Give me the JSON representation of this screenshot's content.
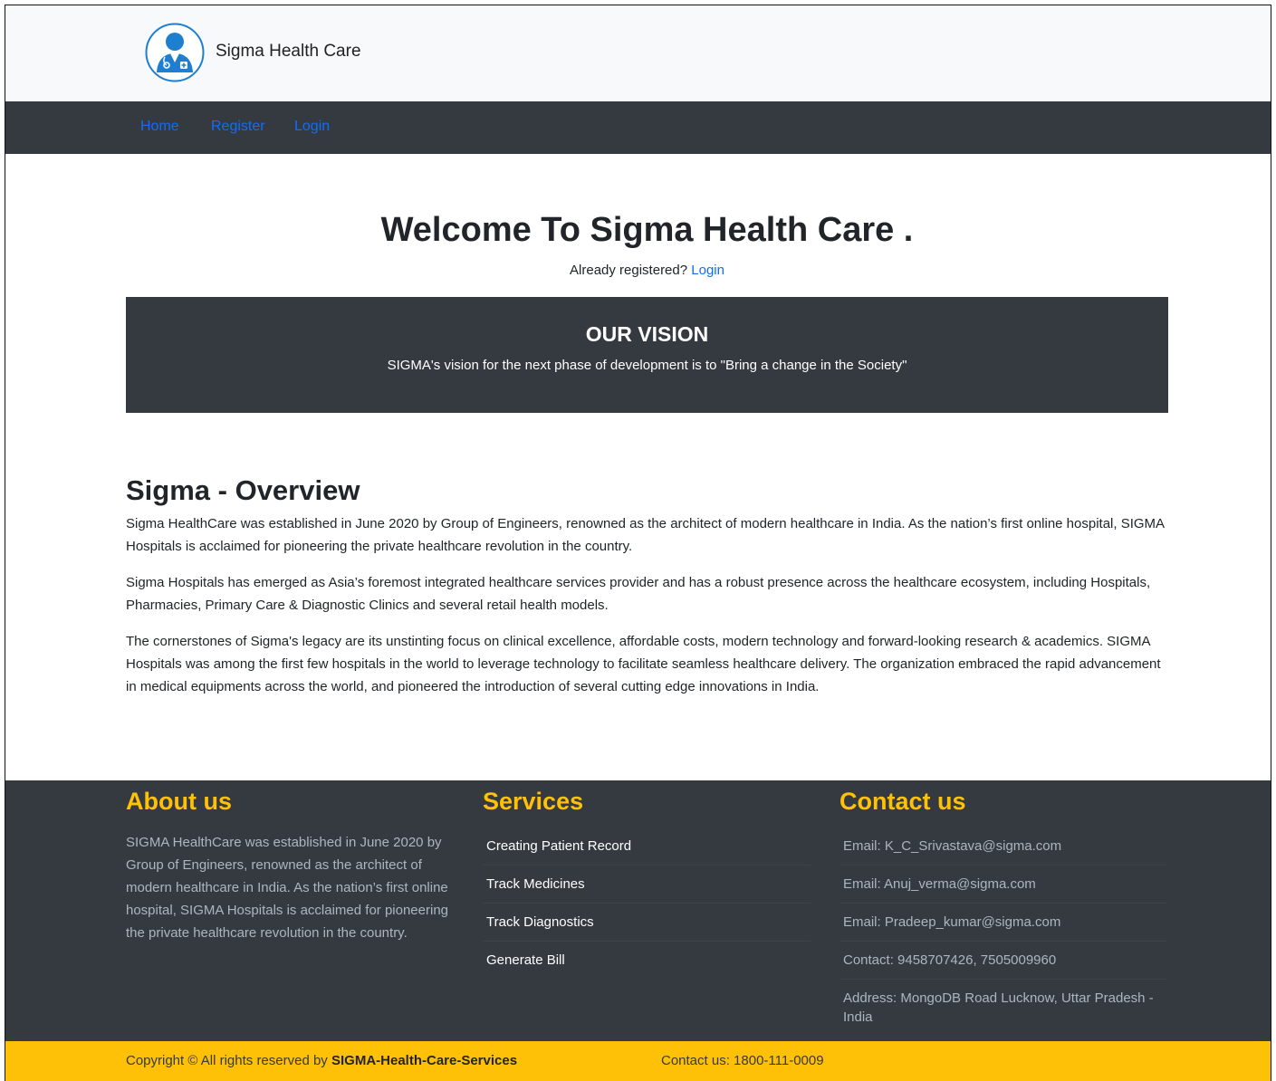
{
  "brand": {
    "name": "Sigma Health Care"
  },
  "nav": {
    "items": [
      {
        "label": "Home"
      },
      {
        "label": "Register"
      },
      {
        "label": "Login"
      }
    ]
  },
  "hero": {
    "title": "Welcome To Sigma Health Care .",
    "already_text": "Already registered?",
    "login_link": "Login"
  },
  "vision": {
    "title": "OUR VISION",
    "text": "SIGMA's vision for the next phase of development is to \"Bring a change in the Society\""
  },
  "overview": {
    "title": "Sigma - Overview",
    "paragraphs": [
      "Sigma HealthCare was established in June 2020 by Group of Engineers, renowned as the architect of modern healthcare in India. As the nation’s first online hospital, SIGMA Hospitals is acclaimed for pioneering the private healthcare revolution in the country.",
      "Sigma Hospitals has emerged as Asia’s foremost integrated healthcare services provider and has a robust presence across the healthcare ecosystem, including Hospitals, Pharmacies, Primary Care & Diagnostic Clinics and several retail health models.",
      "The cornerstones of Sigma's legacy are its unstinting focus on clinical excellence, affordable costs, modern technology and forward-looking research & academics. SIGMA Hospitals was among the first few hospitals in the world to leverage technology to facilitate seamless healthcare delivery. The organization embraced the rapid advancement in medical equipments across the world, and pioneered the introduction of several cutting edge innovations in India."
    ]
  },
  "footer": {
    "about": {
      "title": "About us",
      "text": "SIGMA HealthCare was established in June 2020 by Group of Engineers, renowned as the architect of modern healthcare in India. As the nation’s first online hospital, SIGMA Hospitals is acclaimed for pioneering the private healthcare revolution in the country."
    },
    "services": {
      "title": "Services",
      "items": [
        "Creating Patient Record",
        "Track Medicines",
        "Track Diagnostics",
        "Generate Bill"
      ]
    },
    "contact": {
      "title": "Contact us",
      "items": [
        "Email: K_C_Srivastava@sigma.com",
        "Email: Anuj_verma@sigma.com",
        "Email: Pradeep_kumar@sigma.com",
        "Contact: 9458707426, 7505009960",
        "Address: MongoDB Road Lucknow, Uttar Pradesh - India"
      ]
    }
  },
  "copyright": {
    "prefix": "Copyright © All rights reserved by",
    "company": "SIGMA-Health-Care-Services",
    "contact": "Contact us: 1800-111-0009"
  },
  "colors": {
    "accent": "#ffc107",
    "dark": "#343a40",
    "link": "#0d6efd",
    "logo": "#1e7fd0"
  },
  "icons": {
    "logo": "doctor-avatar-icon"
  }
}
